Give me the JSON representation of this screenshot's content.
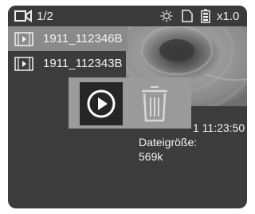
{
  "statusbar": {
    "mode_icon": "video-camera-icon",
    "counter": "1/2",
    "icons": [
      "brightness-icon",
      "sd-card-icon",
      "battery-icon"
    ],
    "zoom": "x1.0"
  },
  "files": [
    {
      "name": "1911_112346B",
      "icon": "video-file-icon",
      "selected": true
    },
    {
      "name": "1911_112343B",
      "icon": "video-file-icon",
      "selected": false
    }
  ],
  "info": {
    "time_partial": "1  11:23:50",
    "size_label": "Dateigröße:",
    "size_value": "569k"
  },
  "actions": {
    "play_icon": "play-icon",
    "delete_icon": "trash-icon"
  },
  "colors": {
    "screen_bg": "#3c3c3c",
    "selected_row": "#8a8a8a",
    "popup_bg": "#9a9a9a",
    "play_bg": "#262626"
  }
}
